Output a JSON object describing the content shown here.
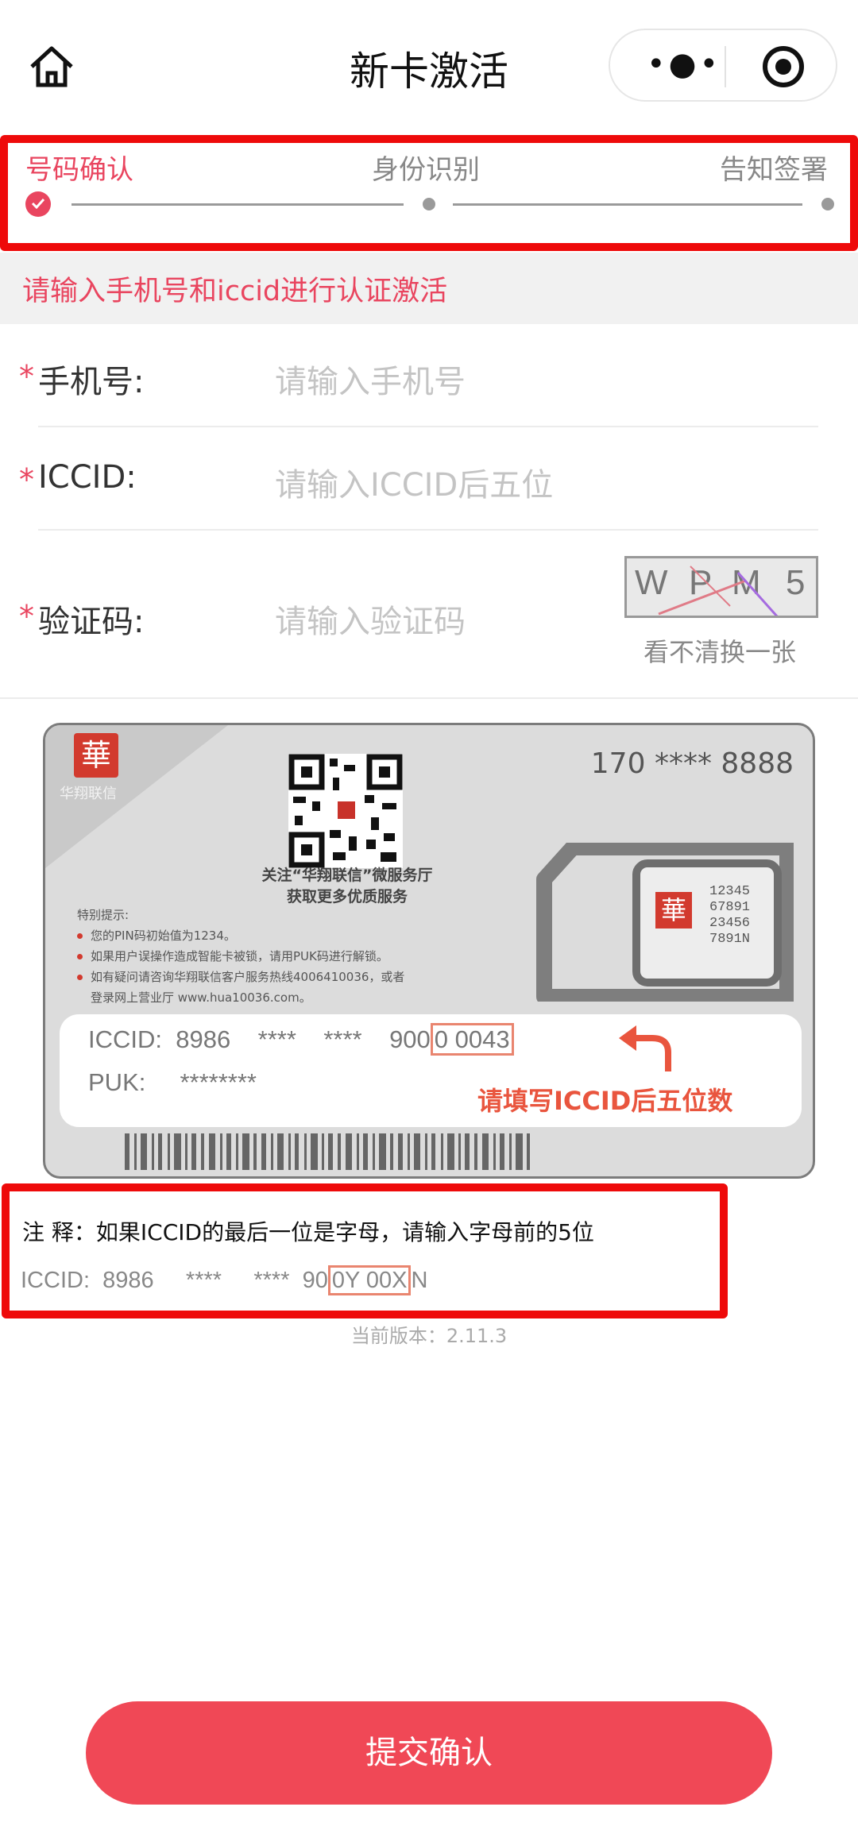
{
  "nav": {
    "title": "新卡激活",
    "home_icon": "home-icon",
    "more_icon": "more-dots-icon",
    "close_icon": "target-circle-icon"
  },
  "stepper": {
    "steps": [
      {
        "label": "号码确认",
        "state": "active"
      },
      {
        "label": "身份识别",
        "state": "pending"
      },
      {
        "label": "告知签署",
        "state": "pending"
      }
    ],
    "accent": "#e9455f"
  },
  "hint": "请输入手机号和iccid进行认证激活",
  "form": {
    "required_mark": "*",
    "phone": {
      "label": "手机号:",
      "placeholder": "请输入手机号"
    },
    "iccid": {
      "label": "ICCID:",
      "placeholder": "请输入ICCID后五位"
    },
    "captcha": {
      "label": "验证码:",
      "placeholder": "请输入验证码",
      "image_text": [
        "W",
        "P",
        "M",
        "5"
      ],
      "refresh": "看不清换一张"
    }
  },
  "card": {
    "logo": "華",
    "brand": "华翔联信",
    "phone": "170 **** 8888",
    "follow": [
      "关注“华翔联信”微服务厅",
      "获取更多优质服务"
    ],
    "tips_title": "特别提示:",
    "tips": [
      "您的PIN码初始值为1234。",
      "如果用户误操作造成智能卡被锁，请用PUK码进行解锁。",
      "如有疑问请咨询华翔联信客户服务热线4006410036，或者",
      "登录网上营业厅 www.hua10036.com。"
    ],
    "sim_numbers": [
      "12345",
      "67891",
      "23456",
      "7891N"
    ],
    "iccid_label": "ICCID:",
    "iccid_prefix": "8986    ****    ****    900",
    "iccid_last5": "0 0043",
    "puk_label": "PUK:",
    "puk_value": "********",
    "fill_hint": "请填写ICCID后五位数"
  },
  "note": {
    "title": "注 释：如果ICCID的最后一位是字母，请输入字母前的5位",
    "iccid_prefix": "ICCID:  8986     ****     ****  90",
    "iccid_boxed": "0Y 00X",
    "iccid_suffix": "N"
  },
  "version": "当前版本：2.11.3",
  "submit_label": "提交确认"
}
